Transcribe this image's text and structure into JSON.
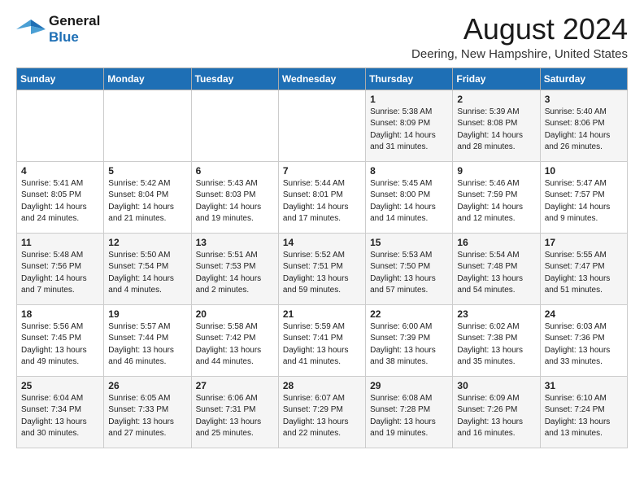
{
  "logo": {
    "line1": "General",
    "line2": "Blue"
  },
  "title": "August 2024",
  "subtitle": "Deering, New Hampshire, United States",
  "headers": [
    "Sunday",
    "Monday",
    "Tuesday",
    "Wednesday",
    "Thursday",
    "Friday",
    "Saturday"
  ],
  "weeks": [
    [
      {
        "day": "",
        "info": ""
      },
      {
        "day": "",
        "info": ""
      },
      {
        "day": "",
        "info": ""
      },
      {
        "day": "",
        "info": ""
      },
      {
        "day": "1",
        "info": "Sunrise: 5:38 AM\nSunset: 8:09 PM\nDaylight: 14 hours\nand 31 minutes."
      },
      {
        "day": "2",
        "info": "Sunrise: 5:39 AM\nSunset: 8:08 PM\nDaylight: 14 hours\nand 28 minutes."
      },
      {
        "day": "3",
        "info": "Sunrise: 5:40 AM\nSunset: 8:06 PM\nDaylight: 14 hours\nand 26 minutes."
      }
    ],
    [
      {
        "day": "4",
        "info": "Sunrise: 5:41 AM\nSunset: 8:05 PM\nDaylight: 14 hours\nand 24 minutes."
      },
      {
        "day": "5",
        "info": "Sunrise: 5:42 AM\nSunset: 8:04 PM\nDaylight: 14 hours\nand 21 minutes."
      },
      {
        "day": "6",
        "info": "Sunrise: 5:43 AM\nSunset: 8:03 PM\nDaylight: 14 hours\nand 19 minutes."
      },
      {
        "day": "7",
        "info": "Sunrise: 5:44 AM\nSunset: 8:01 PM\nDaylight: 14 hours\nand 17 minutes."
      },
      {
        "day": "8",
        "info": "Sunrise: 5:45 AM\nSunset: 8:00 PM\nDaylight: 14 hours\nand 14 minutes."
      },
      {
        "day": "9",
        "info": "Sunrise: 5:46 AM\nSunset: 7:59 PM\nDaylight: 14 hours\nand 12 minutes."
      },
      {
        "day": "10",
        "info": "Sunrise: 5:47 AM\nSunset: 7:57 PM\nDaylight: 14 hours\nand 9 minutes."
      }
    ],
    [
      {
        "day": "11",
        "info": "Sunrise: 5:48 AM\nSunset: 7:56 PM\nDaylight: 14 hours\nand 7 minutes."
      },
      {
        "day": "12",
        "info": "Sunrise: 5:50 AM\nSunset: 7:54 PM\nDaylight: 14 hours\nand 4 minutes."
      },
      {
        "day": "13",
        "info": "Sunrise: 5:51 AM\nSunset: 7:53 PM\nDaylight: 14 hours\nand 2 minutes."
      },
      {
        "day": "14",
        "info": "Sunrise: 5:52 AM\nSunset: 7:51 PM\nDaylight: 13 hours\nand 59 minutes."
      },
      {
        "day": "15",
        "info": "Sunrise: 5:53 AM\nSunset: 7:50 PM\nDaylight: 13 hours\nand 57 minutes."
      },
      {
        "day": "16",
        "info": "Sunrise: 5:54 AM\nSunset: 7:48 PM\nDaylight: 13 hours\nand 54 minutes."
      },
      {
        "day": "17",
        "info": "Sunrise: 5:55 AM\nSunset: 7:47 PM\nDaylight: 13 hours\nand 51 minutes."
      }
    ],
    [
      {
        "day": "18",
        "info": "Sunrise: 5:56 AM\nSunset: 7:45 PM\nDaylight: 13 hours\nand 49 minutes."
      },
      {
        "day": "19",
        "info": "Sunrise: 5:57 AM\nSunset: 7:44 PM\nDaylight: 13 hours\nand 46 minutes."
      },
      {
        "day": "20",
        "info": "Sunrise: 5:58 AM\nSunset: 7:42 PM\nDaylight: 13 hours\nand 44 minutes."
      },
      {
        "day": "21",
        "info": "Sunrise: 5:59 AM\nSunset: 7:41 PM\nDaylight: 13 hours\nand 41 minutes."
      },
      {
        "day": "22",
        "info": "Sunrise: 6:00 AM\nSunset: 7:39 PM\nDaylight: 13 hours\nand 38 minutes."
      },
      {
        "day": "23",
        "info": "Sunrise: 6:02 AM\nSunset: 7:38 PM\nDaylight: 13 hours\nand 35 minutes."
      },
      {
        "day": "24",
        "info": "Sunrise: 6:03 AM\nSunset: 7:36 PM\nDaylight: 13 hours\nand 33 minutes."
      }
    ],
    [
      {
        "day": "25",
        "info": "Sunrise: 6:04 AM\nSunset: 7:34 PM\nDaylight: 13 hours\nand 30 minutes."
      },
      {
        "day": "26",
        "info": "Sunrise: 6:05 AM\nSunset: 7:33 PM\nDaylight: 13 hours\nand 27 minutes."
      },
      {
        "day": "27",
        "info": "Sunrise: 6:06 AM\nSunset: 7:31 PM\nDaylight: 13 hours\nand 25 minutes."
      },
      {
        "day": "28",
        "info": "Sunrise: 6:07 AM\nSunset: 7:29 PM\nDaylight: 13 hours\nand 22 minutes."
      },
      {
        "day": "29",
        "info": "Sunrise: 6:08 AM\nSunset: 7:28 PM\nDaylight: 13 hours\nand 19 minutes."
      },
      {
        "day": "30",
        "info": "Sunrise: 6:09 AM\nSunset: 7:26 PM\nDaylight: 13 hours\nand 16 minutes."
      },
      {
        "day": "31",
        "info": "Sunrise: 6:10 AM\nSunset: 7:24 PM\nDaylight: 13 hours\nand 13 minutes."
      }
    ]
  ]
}
